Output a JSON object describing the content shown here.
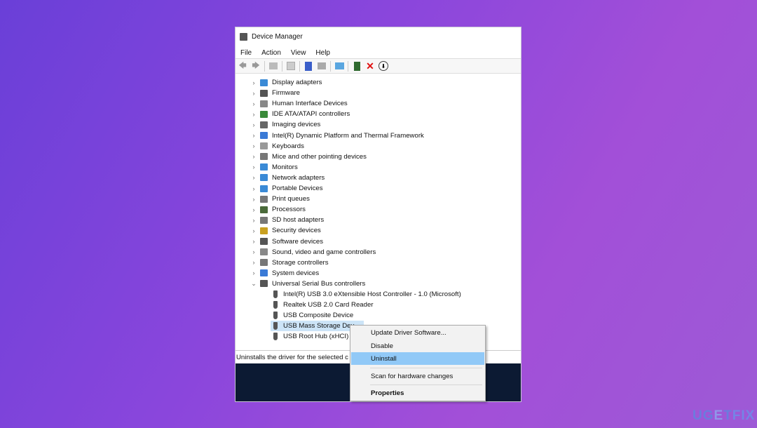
{
  "window": {
    "title": "Device Manager",
    "menu": [
      "File",
      "Action",
      "View",
      "Help"
    ]
  },
  "toolbar": [
    "back-icon",
    "forward-icon",
    "properties-icon",
    "update-icon",
    "help-icon",
    "view-icon",
    "monitor-icon",
    "add-driver-icon",
    "uninstall-x-icon",
    "download-icon"
  ],
  "tree": {
    "categories": [
      {
        "label": "Display adapters",
        "color": "#3a8ad6"
      },
      {
        "label": "Firmware",
        "color": "#555"
      },
      {
        "label": "Human Interface Devices",
        "color": "#888"
      },
      {
        "label": "IDE ATA/ATAPI controllers",
        "color": "#3a8a3a"
      },
      {
        "label": "Imaging devices",
        "color": "#666"
      },
      {
        "label": "Intel(R) Dynamic Platform and Thermal Framework",
        "color": "#3a7ad6"
      },
      {
        "label": "Keyboards",
        "color": "#999"
      },
      {
        "label": "Mice and other pointing devices",
        "color": "#777"
      },
      {
        "label": "Monitors",
        "color": "#3a8ad6"
      },
      {
        "label": "Network adapters",
        "color": "#3a8ad6"
      },
      {
        "label": "Portable Devices",
        "color": "#3a8ad6"
      },
      {
        "label": "Print queues",
        "color": "#777"
      },
      {
        "label": "Processors",
        "color": "#4a6a3a"
      },
      {
        "label": "SD host adapters",
        "color": "#777"
      },
      {
        "label": "Security devices",
        "color": "#c9a020"
      },
      {
        "label": "Software devices",
        "color": "#555"
      },
      {
        "label": "Sound, video and game controllers",
        "color": "#888"
      },
      {
        "label": "Storage controllers",
        "color": "#777"
      },
      {
        "label": "System devices",
        "color": "#3a7ad6"
      },
      {
        "label": "Universal Serial Bus controllers",
        "color": "#555",
        "expanded": true
      }
    ],
    "usb_children": [
      "Intel(R) USB 3.0 eXtensible Host Controller - 1.0 (Microsoft)",
      "Realtek USB 2.0 Card Reader",
      "USB Composite Device",
      "USB Mass Storage Dev",
      "USB Root Hub (xHCI)"
    ],
    "selected": "USB Mass Storage Dev"
  },
  "status": "Uninstalls the driver for the selected c",
  "context_menu": {
    "items": [
      "Update Driver Software...",
      "Disable",
      "Uninstall",
      "Scan for hardware changes",
      "Properties"
    ],
    "highlighted": "Uninstall"
  },
  "watermark": "UGETFIX"
}
